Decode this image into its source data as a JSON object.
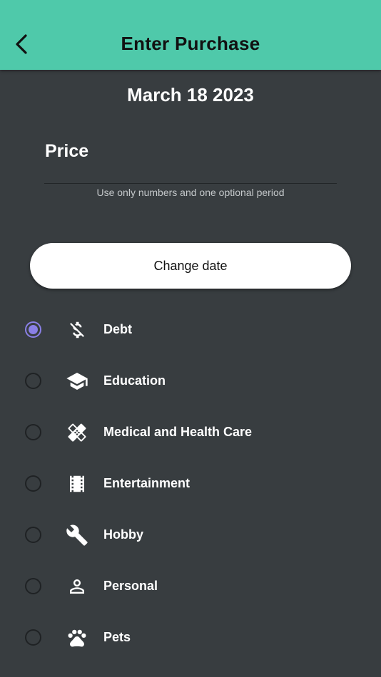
{
  "appbar": {
    "title": "Enter Purchase",
    "back_icon": "arrow-back-icon",
    "color": "#4fc9aa"
  },
  "date": "March 18 2023",
  "price": {
    "label": "Price",
    "value": "",
    "helper": "Use only numbers and one optional period"
  },
  "change_date_label": "Change date",
  "categories": [
    {
      "label": "Debt",
      "icon": "money-off-icon",
      "selected": true
    },
    {
      "label": "Education",
      "icon": "school-icon",
      "selected": false
    },
    {
      "label": "Medical and Health Care",
      "icon": "healing-icon",
      "selected": false
    },
    {
      "label": "Entertainment",
      "icon": "movie-icon",
      "selected": false
    },
    {
      "label": "Hobby",
      "icon": "wrench-icon",
      "selected": false
    },
    {
      "label": "Personal",
      "icon": "person-icon",
      "selected": false
    },
    {
      "label": "Pets",
      "icon": "pets-icon",
      "selected": false
    }
  ],
  "colors": {
    "background": "#383d40",
    "radio_selected": "#8a80e6"
  }
}
